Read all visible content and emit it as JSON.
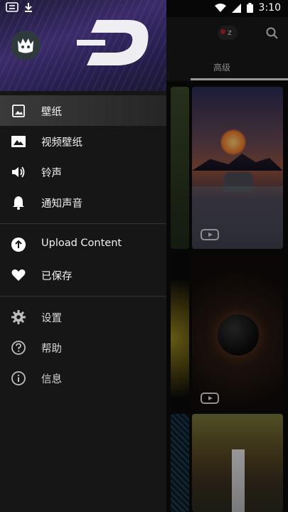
{
  "status_bar": {
    "time": "3:10",
    "left_icons": [
      "chip-notification-icon",
      "download-icon"
    ],
    "right_icons": [
      "wifi-icon",
      "signal-icon",
      "battery-icon"
    ]
  },
  "background": {
    "chip_label": "z",
    "tab_label": "高级"
  },
  "drawer": {
    "avatar_icon": "crown-avatar-icon",
    "logo_icon": "zedge-logo-icon",
    "sections": [
      {
        "items": [
          {
            "label": "壁纸",
            "icon": "image-icon",
            "active": true
          },
          {
            "label": "视频壁纸",
            "icon": "landscape-icon"
          },
          {
            "label": "铃声",
            "icon": "volume-icon"
          },
          {
            "label": "通知声音",
            "icon": "bell-icon"
          }
        ]
      },
      {
        "items": [
          {
            "label": "Upload Content",
            "icon": "upload-icon"
          },
          {
            "label": "已保存",
            "icon": "heart-icon"
          }
        ]
      },
      {
        "items": [
          {
            "label": "设置",
            "icon": "gear-icon"
          },
          {
            "label": "帮助",
            "icon": "help-icon"
          },
          {
            "label": "信息",
            "icon": "info-icon"
          }
        ]
      }
    ]
  }
}
